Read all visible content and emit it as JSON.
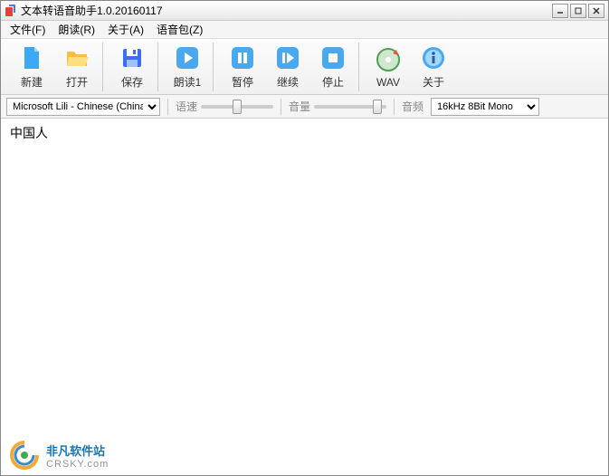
{
  "window": {
    "title": "文本转语音助手1.0.20160117"
  },
  "menu": {
    "file": "文件(F)",
    "read": "朗读(R)",
    "about": "关于(A)",
    "voicepack": "语音包(Z)"
  },
  "toolbar": {
    "new": "新建",
    "open": "打开",
    "save": "保存",
    "read1": "朗读1",
    "pause": "暂停",
    "resume": "继续",
    "stop": "停止",
    "wav": "WAV",
    "about": "关于"
  },
  "options": {
    "voice": "Microsoft Lili - Chinese (China)",
    "speed_label": "语速",
    "volume_label": "音量",
    "freq_label": "音频",
    "freq_value": "16kHz 8Bit Mono"
  },
  "content": {
    "text": "中国人"
  },
  "watermark": {
    "cn": "非凡软件站",
    "en": "CRSKY.com"
  }
}
